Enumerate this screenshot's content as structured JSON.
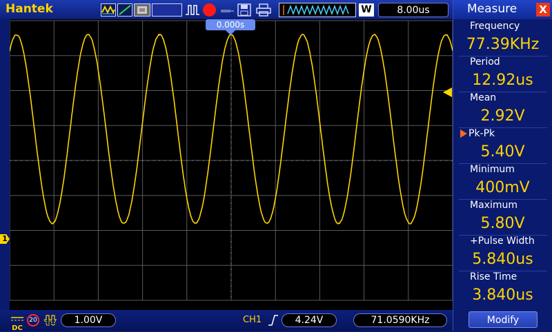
{
  "header": {
    "brand": "Hantek",
    "run_mode_letter": "W",
    "timebase": "8.00us",
    "trigger_position": "0.000s"
  },
  "icons": [
    "waveform-type-icon",
    "ramp-icon",
    "memory-icon",
    "pulse-icon",
    "record-icon",
    "probe-icon",
    "save-icon",
    "print-icon",
    "acquisition-wave-icon"
  ],
  "colors": {
    "trace": "#ffd400",
    "grid": "#5a5a5a",
    "panel": "#0a1a6e",
    "record": "#ff1a1a",
    "selected_arrow": "#ff6a1a"
  },
  "waveform": {
    "frequency_khz": 77.39,
    "min_v": 0.4,
    "max_v": 5.8,
    "volts_per_div": 1.0,
    "time_per_div_us": 8.0
  },
  "footer": {
    "coupling": "DC",
    "bandwidth_limit": "20",
    "ch1_scale": "1.00V",
    "trigger_source": "CH1",
    "trigger_level": "4.24V",
    "trigger_frequency": "71.0590KHz"
  },
  "measure": {
    "title": "Measure",
    "close": "X",
    "items": [
      {
        "label": "Frequency",
        "value": "77.39KHz"
      },
      {
        "label": "Period",
        "value": "12.92us"
      },
      {
        "label": "Mean",
        "value": "2.92V"
      },
      {
        "label": "Pk-Pk",
        "value": "5.40V"
      },
      {
        "label": "Minimum",
        "value": "400mV"
      },
      {
        "label": "Maximum",
        "value": "5.80V"
      },
      {
        "label": "+Pulse Width",
        "value": "5.840us"
      },
      {
        "label": "Rise Time",
        "value": "3.840us"
      }
    ],
    "modify": "Modify"
  }
}
